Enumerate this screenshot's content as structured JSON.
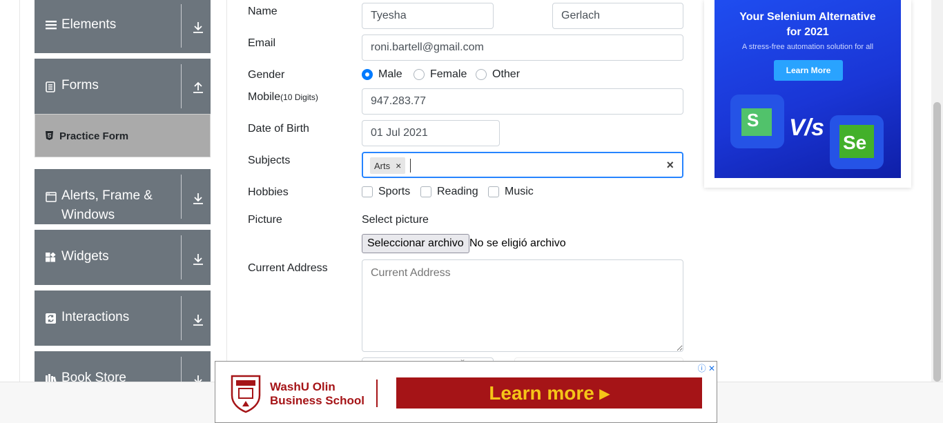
{
  "sidebar": {
    "groups": [
      {
        "title": "Elements",
        "icon": "hamburger-icon"
      },
      {
        "title": "Forms",
        "icon": "form-icon"
      },
      {
        "title": "Alerts, Frame &",
        "title2": "Windows",
        "icon": "window-icon"
      },
      {
        "title": "Widgets",
        "icon": "widgets-icon"
      },
      {
        "title": "Interactions",
        "icon": "interactions-icon"
      },
      {
        "title": "Book Store",
        "icon": "bookstore-icon"
      }
    ],
    "active_item": "Practice Form"
  },
  "form": {
    "labels": {
      "name": "Name",
      "email": "Email",
      "gender": "Gender",
      "mobile": "Mobile",
      "mobile_hint": "(10 Digits)",
      "dob": "Date of Birth",
      "subjects": "Subjects",
      "hobbies": "Hobbies",
      "picture": "Picture",
      "current_address": "Current Address"
    },
    "first_name": "Tyesha",
    "last_name": "Gerlach",
    "email": "roni.bartell@gmail.com",
    "gender_options": [
      "Male",
      "Female",
      "Other"
    ],
    "gender_selected": "Male",
    "mobile": "947.283.77",
    "dob": "01 Jul 2021",
    "subjects_selected": [
      "Arts"
    ],
    "subjects_clear": "×",
    "chip_remove": "×",
    "hobbies_options": [
      "Sports",
      "Reading",
      "Music"
    ],
    "picture_caption": "Select picture",
    "file_button": "Seleccionar archivo",
    "file_status": "No se eligió archivo",
    "address_placeholder": "Current Address"
  },
  "side_ad": {
    "title_line1": "Your Selenium Alternative",
    "title_line2": "for 2021",
    "subtitle": "A stress-free automation solution for all",
    "button": "Learn More",
    "vs_text": "V/s",
    "logo_right": "Se",
    "logo_left": "S"
  },
  "bottom_ad": {
    "brand_line1": "WashU Olin",
    "brand_line2": "Business School",
    "cta": "Learn more ▸",
    "adchoices": "ⓘ ✕"
  },
  "colors": {
    "sidebar_bg": "#6c757d",
    "sidebar_active_bg": "#aaaaaa",
    "focus_border": "#2684ff",
    "radio_on": "#007bff",
    "ad_brand": "#a51417",
    "ad_cta_text": "#f5c518"
  }
}
